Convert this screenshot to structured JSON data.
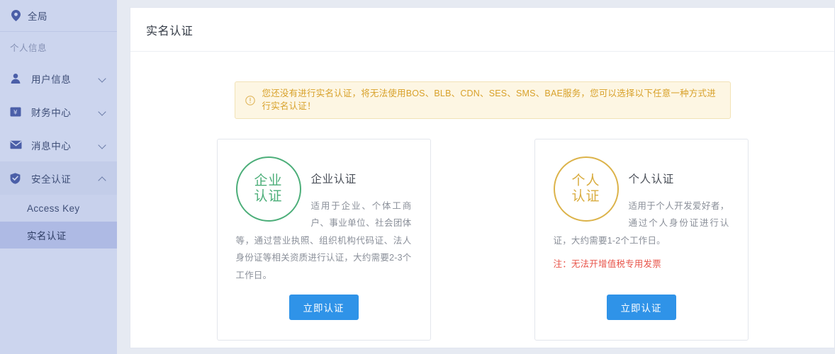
{
  "sidebar": {
    "scope": {
      "label": "全局",
      "icon": "location-pin-icon"
    },
    "section_label": "个人信息",
    "items": [
      {
        "label": "用户信息",
        "icon": "user-icon",
        "chevron": "chevron-down-icon",
        "expanded": false
      },
      {
        "label": "财务中心",
        "icon": "yuan-icon",
        "chevron": "chevron-down-icon",
        "expanded": false
      },
      {
        "label": "消息中心",
        "icon": "envelope-icon",
        "chevron": "chevron-down-icon",
        "expanded": false
      },
      {
        "label": "安全认证",
        "icon": "shield-icon",
        "chevron": "chevron-up-icon",
        "expanded": true
      }
    ],
    "sub_items": [
      {
        "label": "Access Key",
        "active": false
      },
      {
        "label": "实名认证",
        "active": true
      }
    ]
  },
  "header": {
    "title": "实名认证"
  },
  "alert": {
    "icon": "exclamation-circle-icon",
    "text": "您还没有进行实名认证，将无法使用BOS、BLB、CDN、SES、SMS、BAE服务，您可以选择以下任意一种方式进行实名认证！",
    "background": "#fdf6e3",
    "border_color": "#f2e2b6",
    "text_color": "#d8a12a"
  },
  "cards": [
    {
      "badge_line1": "企业",
      "badge_line2": "认证",
      "badge_color": "#4cae79",
      "title": "企业认证",
      "description": "适用于企业、个体工商户、事业单位、社会团体等，通过营业执照、组织机构代码证、法人身份证等相关资质进行认证，大约需要2-3个工作日。",
      "note": "",
      "button_label": "立即认证"
    },
    {
      "badge_line1": "个人",
      "badge_line2": "认证",
      "badge_color": "#d9ad41",
      "title": "个人认证",
      "description": "适用于个人开发爱好者，通过个人身份证进行认证，大约需要1-2个工作日。",
      "note": "注：无法开增值税专用发票",
      "button_label": "立即认证"
    }
  ],
  "theme": {
    "sidebar_bg": "#ccd5ee",
    "sidebar_active": "#aebae4",
    "page_bg": "#e6eaf2",
    "primary_button": "#2f93e8",
    "note_color": "#e8544a"
  }
}
